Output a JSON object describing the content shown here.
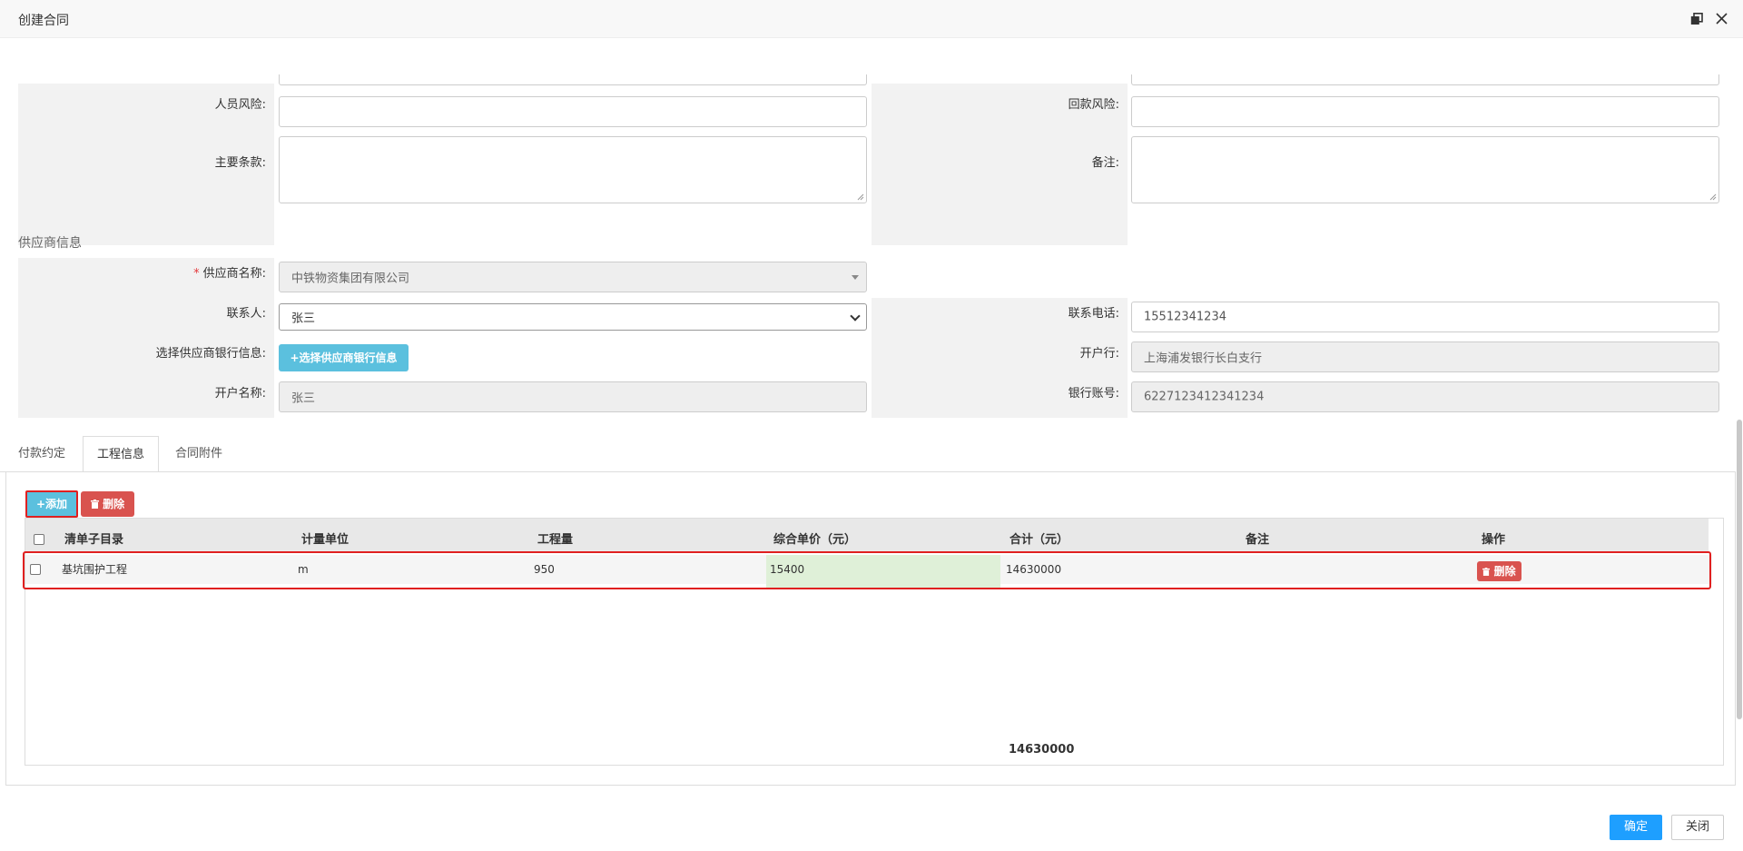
{
  "window": {
    "title": "创建合同"
  },
  "contract_form": {
    "personnel_risk_label": "人员风险:",
    "payment_risk_label": "回款风险:",
    "main_terms_label": "主要条款:",
    "remarks_label": "备注:"
  },
  "supplier": {
    "section_title": "供应商信息",
    "required_mark": "*",
    "name_label": "供应商名称:",
    "name_value": "中铁物资集团有限公司",
    "contact_label": "联系人:",
    "contact_value": "张三",
    "phone_label": "联系电话:",
    "phone_value": "15512341234",
    "bank_select_label": "选择供应商银行信息:",
    "bank_select_button": "+选择供应商银行信息",
    "bank_label": "开户行:",
    "bank_value": "上海浦发银行长白支行",
    "account_name_label": "开户名称:",
    "account_name_value": "张三",
    "account_no_label": "银行账号:",
    "account_no_value": "6227123412341234"
  },
  "tabs": [
    {
      "label": "付款约定",
      "active": false
    },
    {
      "label": "工程信息",
      "active": true
    },
    {
      "label": "合同附件",
      "active": false
    }
  ],
  "toolbar": {
    "add_label": "+添加",
    "delete_label": "删除"
  },
  "grid": {
    "columns": [
      "清单子目录",
      "计量单位",
      "工程量",
      "综合单价（元）",
      "合计（元）",
      "备注",
      "操作"
    ],
    "rows": [
      {
        "item": "基坑围护工程",
        "unit": "m",
        "quantity": "950",
        "unit_price": "15400",
        "total": "14630000",
        "remark": "",
        "delete_label": "删除"
      }
    ],
    "footer_total": "14630000"
  },
  "footer": {
    "confirm_label": "确定",
    "close_label": "关闭"
  },
  "colors": {
    "info": "#5bc0de",
    "danger": "#d9534f",
    "primary": "#1e9fff",
    "highlight": "#e02020",
    "editing_cell": "#dff0d8"
  }
}
